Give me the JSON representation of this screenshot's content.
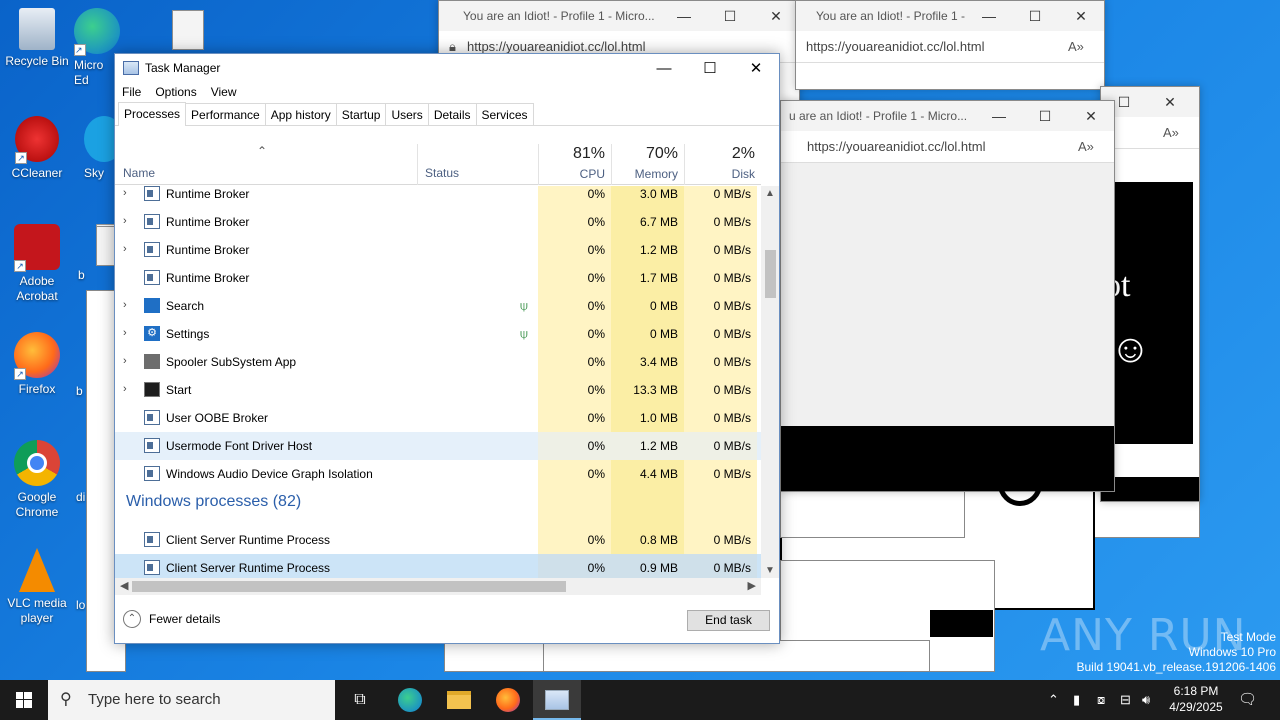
{
  "desktop_icons": [
    {
      "label": "Recycle Bin",
      "icon": "recycle-bin-icon"
    },
    {
      "label": "Micro Ed",
      "icon": "edge-icon"
    },
    {
      "label": "CCleaner",
      "icon": "ccleaner-icon"
    },
    {
      "label": "Sky",
      "icon": "skype-icon"
    },
    {
      "label": "Adobe Acrobat",
      "icon": "acrobat-icon"
    },
    {
      "label": "b",
      "icon": "file-icon"
    },
    {
      "label": "Firefox",
      "icon": "firefox-icon"
    },
    {
      "label": "b",
      "icon": "file-icon"
    },
    {
      "label": "Google Chrome",
      "icon": "chrome-icon"
    },
    {
      "label": "di",
      "icon": "file-icon"
    },
    {
      "label": "VLC media player",
      "icon": "vlc-icon"
    },
    {
      "label": "lo",
      "icon": "file-icon"
    }
  ],
  "browser": {
    "title": "You are an Idiot! - Profile 1 - Micro...",
    "title_b": "You are an Idiot! - Profile 1 - Micro...",
    "title_c": "u are an Idiot! - Profile 1 - Micro...",
    "url": "https://youareanidiot.cc/lol.html",
    "page_text": "ot"
  },
  "task_manager": {
    "title": "Task Manager",
    "menu": [
      "File",
      "Options",
      "View"
    ],
    "tabs": [
      "Processes",
      "Performance",
      "App history",
      "Startup",
      "Users",
      "Details",
      "Services"
    ],
    "active_tab": "Processes",
    "columns": {
      "name": "Name",
      "status": "Status",
      "cpu_pct": "81%",
      "cpu": "CPU",
      "mem_pct": "70%",
      "mem": "Memory",
      "disk_pct": "2%",
      "disk": "Disk"
    },
    "rows": [
      {
        "name": "Runtime Broker",
        "expand": true,
        "cpu": "0%",
        "mem": "3.0 MB",
        "disk": "0 MB/s",
        "icon": "app-box-icon"
      },
      {
        "name": "Runtime Broker",
        "expand": true,
        "cpu": "0%",
        "mem": "6.7 MB",
        "disk": "0 MB/s",
        "icon": "app-box-icon"
      },
      {
        "name": "Runtime Broker",
        "expand": true,
        "cpu": "0%",
        "mem": "1.2 MB",
        "disk": "0 MB/s",
        "icon": "app-box-icon"
      },
      {
        "name": "Runtime Broker",
        "expand": false,
        "cpu": "0%",
        "mem": "1.7 MB",
        "disk": "0 MB/s",
        "icon": "app-box-icon"
      },
      {
        "name": "Search",
        "expand": true,
        "cpu": "0%",
        "mem": "0 MB",
        "disk": "0 MB/s",
        "icon": "search-icon",
        "suspended": true
      },
      {
        "name": "Settings",
        "expand": true,
        "cpu": "0%",
        "mem": "0 MB",
        "disk": "0 MB/s",
        "icon": "gear-icon",
        "suspended": true
      },
      {
        "name": "Spooler SubSystem App",
        "expand": true,
        "cpu": "0%",
        "mem": "3.4 MB",
        "disk": "0 MB/s",
        "icon": "printer-icon"
      },
      {
        "name": "Start",
        "expand": true,
        "cpu": "0%",
        "mem": "13.3 MB",
        "disk": "0 MB/s",
        "icon": "start-icon"
      },
      {
        "name": "User OOBE Broker",
        "expand": false,
        "cpu": "0%",
        "mem": "1.0 MB",
        "disk": "0 MB/s",
        "icon": "app-box-icon"
      },
      {
        "name": "Usermode Font Driver Host",
        "expand": false,
        "cpu": "0%",
        "mem": "1.2 MB",
        "disk": "0 MB/s",
        "icon": "app-box-icon",
        "state": "hover"
      },
      {
        "name": "Windows Audio Device Graph Isolation",
        "expand": false,
        "cpu": "0%",
        "mem": "4.4 MB",
        "disk": "0 MB/s",
        "icon": "app-box-icon"
      }
    ],
    "group": "Windows processes (82)",
    "group_rows": [
      {
        "name": "Client Server Runtime Process",
        "expand": false,
        "cpu": "0%",
        "mem": "0.8 MB",
        "disk": "0 MB/s",
        "icon": "app-box-icon"
      },
      {
        "name": "Client Server Runtime Process",
        "expand": false,
        "cpu": "0%",
        "mem": "0.9 MB",
        "disk": "0 MB/s",
        "icon": "app-box-icon",
        "state": "selected"
      }
    ],
    "fewer_details": "Fewer details",
    "end_task": "End task"
  },
  "taskbar": {
    "search_placeholder": "Type here to search",
    "time": "6:18 PM",
    "date": "4/29/2025"
  },
  "watermark": {
    "brand": "ANY RUN",
    "line1": "Test Mode",
    "line2": "Windows 10 Pro",
    "line3": "Build 19041.vb_release.191206-1406"
  }
}
